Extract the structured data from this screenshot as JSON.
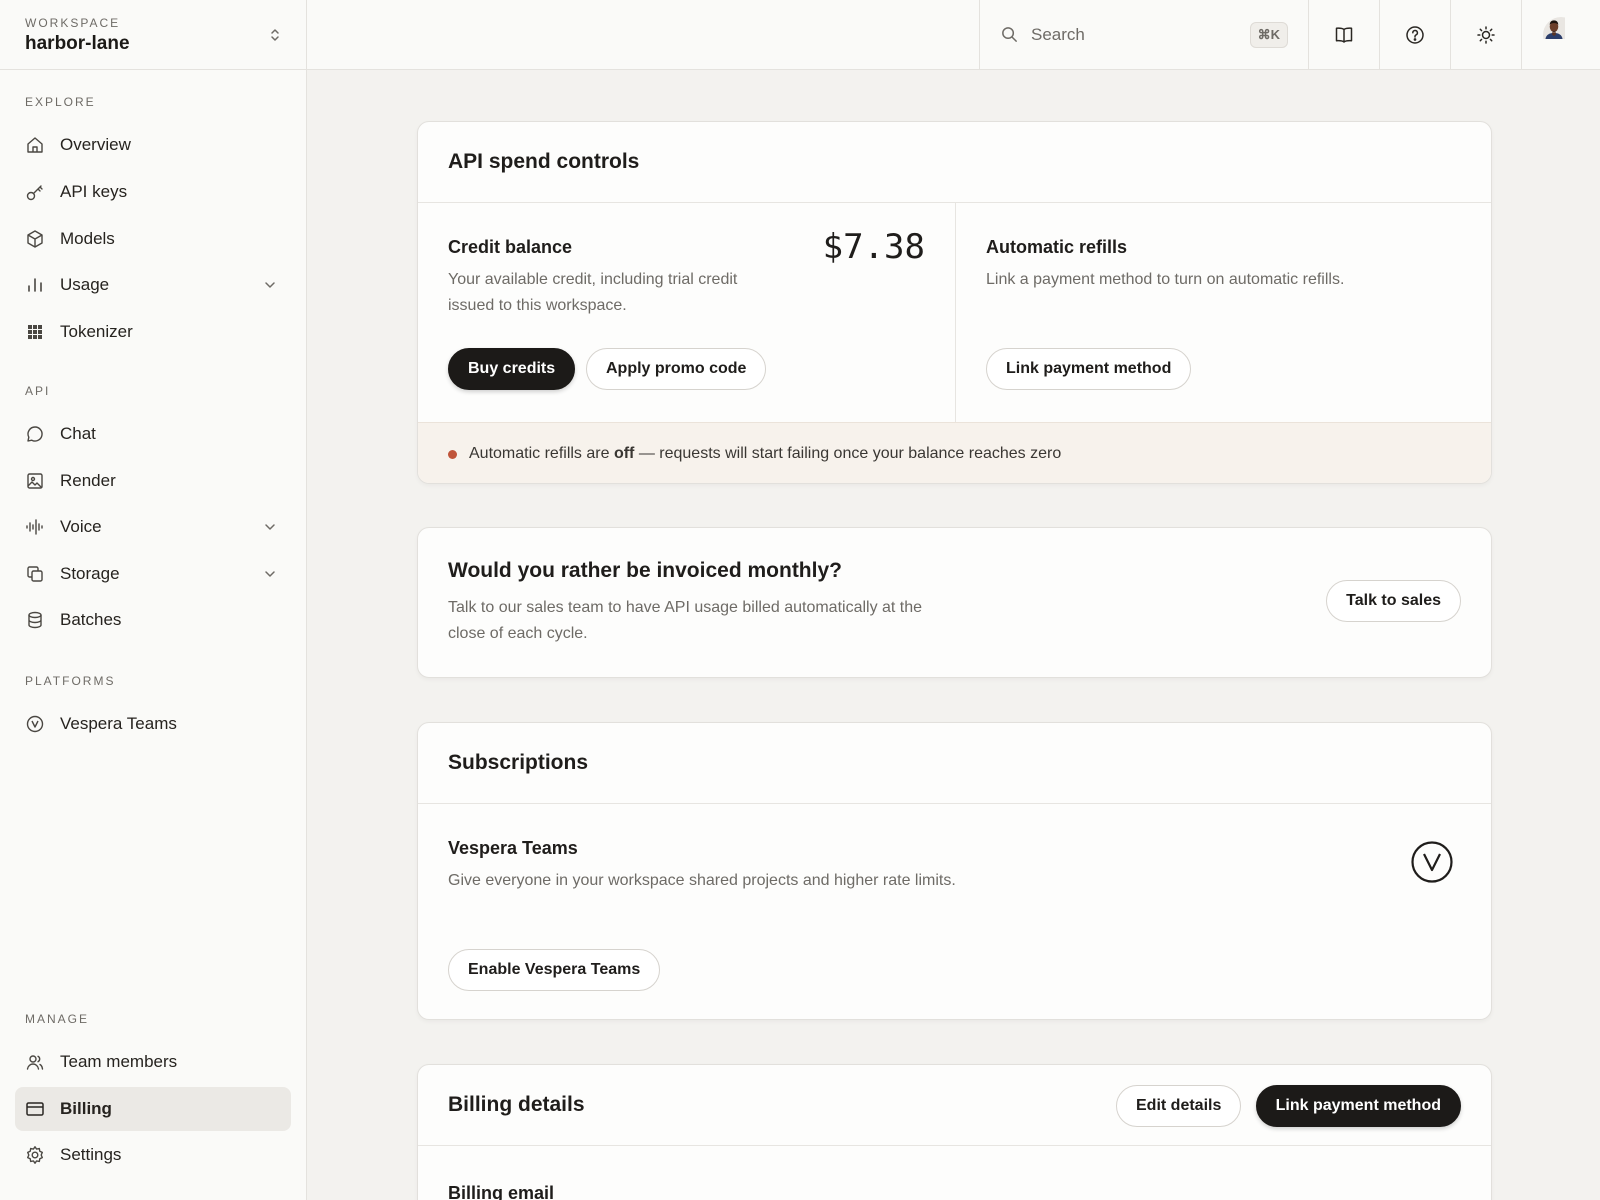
{
  "workspace": {
    "label": "WORKSPACE",
    "name": "harbor-lane"
  },
  "sidebar": {
    "sections": {
      "explore": "EXPLORE",
      "api": "API",
      "platforms": "PLATFORMS",
      "manage": "MANAGE"
    },
    "explore": [
      {
        "label": "Overview",
        "icon": "home-icon"
      },
      {
        "label": "API keys",
        "icon": "key-icon"
      },
      {
        "label": "Models",
        "icon": "cube-icon"
      },
      {
        "label": "Usage",
        "icon": "bar-chart-icon",
        "expandable": true
      },
      {
        "label": "Tokenizer",
        "icon": "grid-icon"
      }
    ],
    "api": [
      {
        "label": "Chat",
        "icon": "chat-bubble-icon"
      },
      {
        "label": "Render",
        "icon": "image-icon"
      },
      {
        "label": "Voice",
        "icon": "waveform-icon",
        "expandable": true
      },
      {
        "label": "Storage",
        "icon": "copy-icon",
        "expandable": true
      },
      {
        "label": "Batches",
        "icon": "database-icon"
      }
    ],
    "platforms": [
      {
        "label": "Vespera Teams",
        "icon": "vespera-logo-icon"
      }
    ],
    "manage": [
      {
        "label": "Team members",
        "icon": "users-icon"
      },
      {
        "label": "Billing",
        "icon": "credit-card-icon",
        "active": true
      },
      {
        "label": "Settings",
        "icon": "gear-icon"
      }
    ]
  },
  "topbar": {
    "search_placeholder": "Search",
    "search_shortcut": "⌘K",
    "icons": [
      "book-icon",
      "help-icon",
      "sun-icon",
      "avatar"
    ]
  },
  "spend": {
    "title": "API spend controls",
    "credit": {
      "title": "Credit balance",
      "description": "Your available credit, including trial credit issued to this workspace.",
      "amount": "$7.38",
      "buy": "Buy credits",
      "promo": "Apply promo code"
    },
    "refills": {
      "title": "Automatic refills",
      "description": "Link a payment method to turn on automatic refills.",
      "link": "Link payment method"
    },
    "notice": {
      "prefix": "Automatic refills are ",
      "status": "off",
      "suffix": " — requests will start failing once your balance reaches zero",
      "dot_color": "#c0553a"
    }
  },
  "invoice": {
    "title": "Would you rather be invoiced monthly?",
    "description": "Talk to our sales team to have API usage billed automatically at the close of each cycle.",
    "button": "Talk to sales"
  },
  "subscriptions": {
    "title": "Subscriptions",
    "item": {
      "title": "Vespera Teams",
      "description": "Give everyone in your workspace shared projects and higher rate limits.",
      "button": "Enable Vespera Teams",
      "icon": "vespera-logo-icon"
    }
  },
  "billing": {
    "title": "Billing details",
    "edit": "Edit details",
    "link": "Link payment method",
    "email_label": "Billing email"
  },
  "colors": {
    "accent_dark": "#1c1a18",
    "background": "#f3f2ef",
    "notice_bg": "#f7f2ec"
  }
}
